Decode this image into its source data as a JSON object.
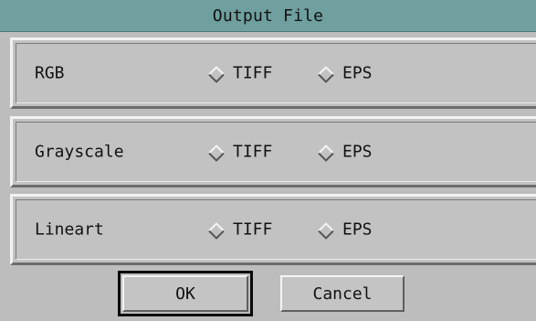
{
  "dialog": {
    "title": "Output File"
  },
  "rows": [
    {
      "label": "RGB",
      "options": [
        "TIFF",
        "EPS"
      ],
      "selected": null
    },
    {
      "label": "Grayscale",
      "options": [
        "TIFF",
        "EPS"
      ],
      "selected": null
    },
    {
      "label": "Lineart",
      "options": [
        "TIFF",
        "EPS"
      ],
      "selected": null
    }
  ],
  "buttons": {
    "ok_label": "OK",
    "cancel_label": "Cancel"
  },
  "colors": {
    "titlebar": "#6f9f9f",
    "background": "#bdbdbd"
  },
  "icons": {
    "radio": "diamond-radio-icon"
  }
}
